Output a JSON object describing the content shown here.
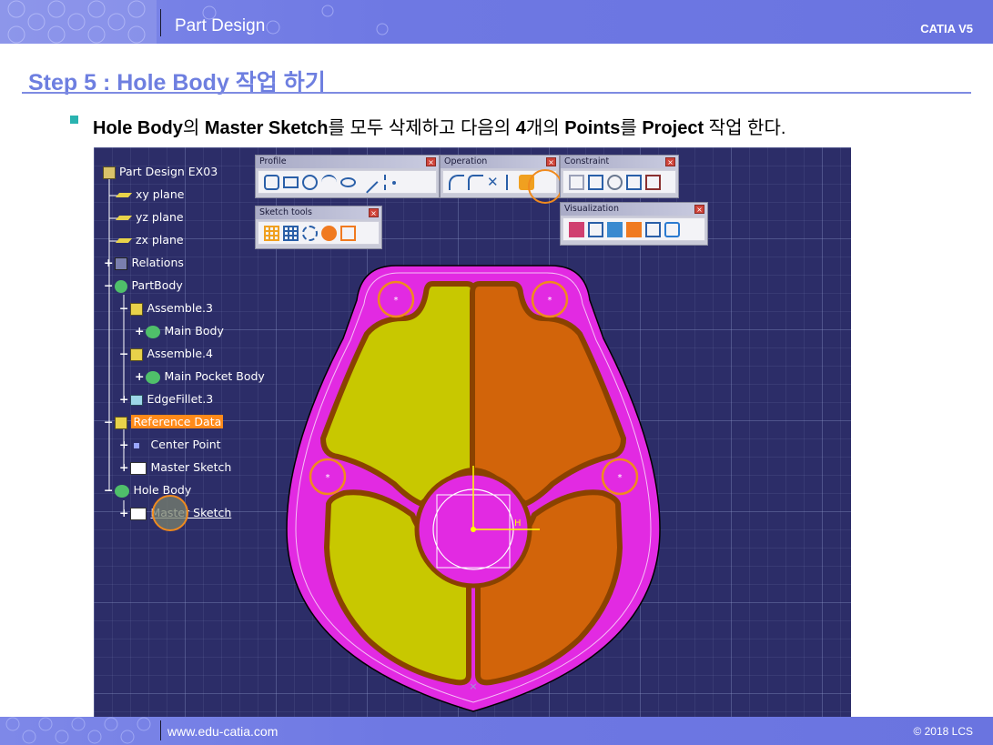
{
  "header": {
    "title": "Part Design",
    "brand": "CATIA V5"
  },
  "step": {
    "title": "Step 5 : Hole Body 작업 하기"
  },
  "bullet": {
    "text_parts": [
      "Hole Body",
      "의 ",
      "Master Sketch",
      "를 모두 삭제하고 다음의 ",
      "4",
      "개의 ",
      "Points",
      "를 ",
      "Project",
      " 작업 한다."
    ]
  },
  "tree": {
    "items": [
      {
        "label": "Part Design EX03"
      },
      {
        "label": "xy plane"
      },
      {
        "label": "yz plane"
      },
      {
        "label": "zx plane"
      },
      {
        "label": "Relations"
      },
      {
        "label": "PartBody"
      },
      {
        "label": "Assemble.3"
      },
      {
        "label": "Main Body"
      },
      {
        "label": "Assemble.4"
      },
      {
        "label": "Main Pocket Body"
      },
      {
        "label": "EdgeFillet.3"
      },
      {
        "label": "Reference Data"
      },
      {
        "label": "Center Point"
      },
      {
        "label": "Master Sketch"
      },
      {
        "label": "Hole Body"
      },
      {
        "label": "Master Sketch"
      }
    ]
  },
  "toolbars": {
    "profile": {
      "title": "Profile"
    },
    "operation": {
      "title": "Operation"
    },
    "constraint": {
      "title": "Constraint"
    },
    "sketch_tools": {
      "title": "Sketch tools"
    },
    "visualization": {
      "title": "Visualization"
    }
  },
  "colors": {
    "header": "#6e78e3",
    "step_title": "#6e7fe0",
    "viewport_bg": "#2c2d68",
    "part_magenta": "#e22ae2",
    "pocket_yellow": "#c8c800",
    "pocket_orange": "#d2640a",
    "highlight_circle": "#f08a1e"
  },
  "footer": {
    "url": "www.edu-catia.com",
    "copyright": "© 2018 LCS"
  }
}
